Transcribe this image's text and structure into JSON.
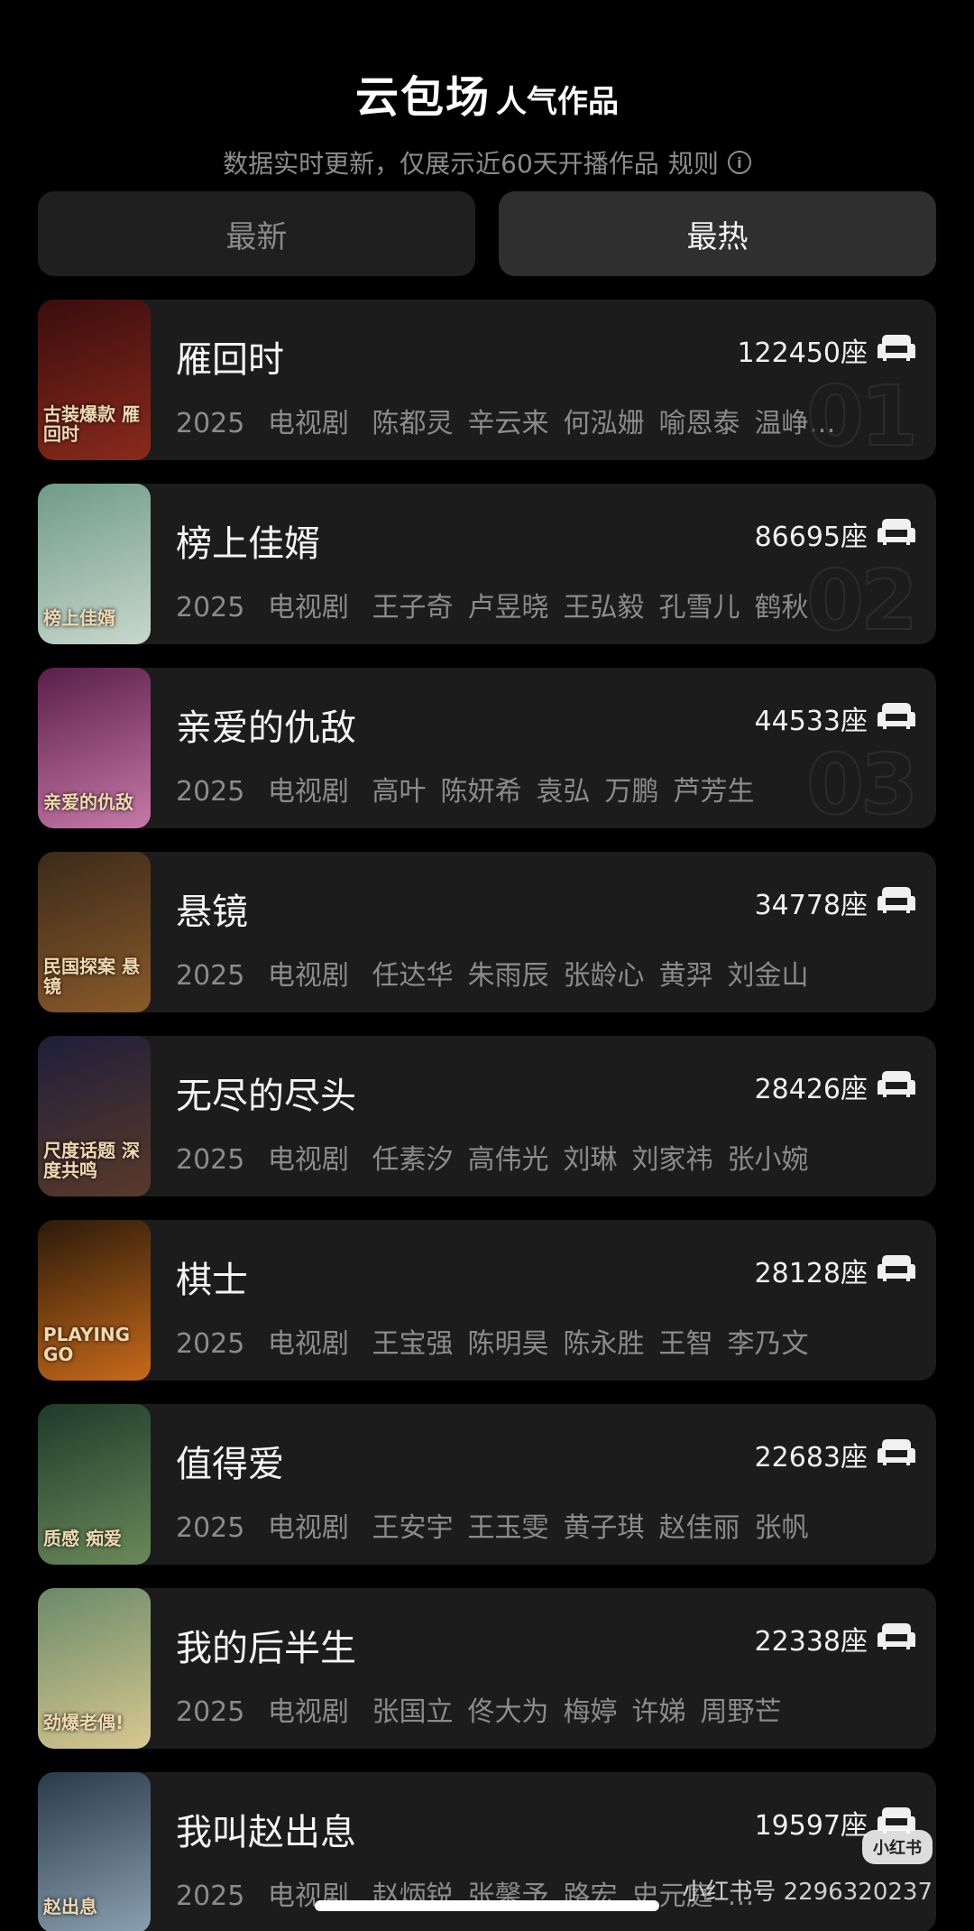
{
  "header": {
    "brand": "云包场",
    "brand_sub": "人气作品",
    "subtitle": "数据实时更新，仅展示近60天开播作品",
    "rules_label": "规则"
  },
  "tabs": [
    {
      "label": "最新",
      "active": false
    },
    {
      "label": "最热",
      "active": true
    }
  ],
  "items": [
    {
      "rank": "01",
      "title": "雁回时",
      "seats": "122450座",
      "year": "2025",
      "category": "电视剧",
      "cast": [
        "陈都灵",
        "辛云来",
        "何泓姗",
        "喻恩泰",
        "温峥…"
      ],
      "poster_text": "古装爆款 雁回时",
      "poster_colors": [
        "#3a0d0d",
        "#8a2a1c"
      ]
    },
    {
      "rank": "02",
      "title": "榜上佳婿",
      "seats": "86695座",
      "year": "2025",
      "category": "电视剧",
      "cast": [
        "王子奇",
        "卢昱晓",
        "王弘毅",
        "孔雪儿",
        "鹤秋"
      ],
      "poster_text": "榜上佳婿",
      "poster_colors": [
        "#6f9a8a",
        "#c8d8cc"
      ]
    },
    {
      "rank": "03",
      "title": "亲爱的仇敌",
      "seats": "44533座",
      "year": "2025",
      "category": "电视剧",
      "cast": [
        "高叶",
        "陈妍希",
        "袁弘",
        "万鹏",
        "芦芳生"
      ],
      "poster_text": "亲爱的仇敌",
      "poster_colors": [
        "#5a1e4a",
        "#c77aa8"
      ]
    },
    {
      "rank": "",
      "title": "悬镜",
      "seats": "34778座",
      "year": "2025",
      "category": "电视剧",
      "cast": [
        "任达华",
        "朱雨辰",
        "张龄心",
        "黄羿",
        "刘金山"
      ],
      "poster_text": "民国探案 悬镜",
      "poster_colors": [
        "#3b2a1a",
        "#8a5a2a"
      ]
    },
    {
      "rank": "",
      "title": "无尽的尽头",
      "seats": "28426座",
      "year": "2025",
      "category": "电视剧",
      "cast": [
        "任素汐",
        "高伟光",
        "刘琳",
        "刘家祎",
        "张小婉"
      ],
      "poster_text": "尺度话题 深度共鸣",
      "poster_colors": [
        "#1e1e3a",
        "#5a3a2a"
      ]
    },
    {
      "rank": "",
      "title": "棋士",
      "seats": "28128座",
      "year": "2025",
      "category": "电视剧",
      "cast": [
        "王宝强",
        "陈明昊",
        "陈永胜",
        "王智",
        "李乃文"
      ],
      "poster_text": "PLAYING GO",
      "poster_colors": [
        "#2a1a0a",
        "#c86a1a"
      ]
    },
    {
      "rank": "",
      "title": "值得爱",
      "seats": "22683座",
      "year": "2025",
      "category": "电视剧",
      "cast": [
        "王安宇",
        "王玉雯",
        "黄子琪",
        "赵佳丽",
        "张帆"
      ],
      "poster_text": "质感 痴爱",
      "poster_colors": [
        "#1e3a2a",
        "#6a8a5a"
      ]
    },
    {
      "rank": "",
      "title": "我的后半生",
      "seats": "22338座",
      "year": "2025",
      "category": "电视剧",
      "cast": [
        "张国立",
        "佟大为",
        "梅婷",
        "许娣",
        "周野芒"
      ],
      "poster_text": "劲爆老偶!",
      "poster_colors": [
        "#6a8a6a",
        "#d8c890"
      ]
    },
    {
      "rank": "",
      "title": "我叫赵出息",
      "seats": "19597座",
      "year": "2025",
      "category": "电视剧",
      "cast": [
        "赵炳锐",
        "张馨予",
        "路宏",
        "史元庭",
        "…"
      ],
      "poster_text": "赵出息",
      "poster_colors": [
        "#2a3a4a",
        "#8aa0b0"
      ]
    }
  ],
  "watermark": {
    "badge": "小红书",
    "id": "小红书号 2296320237"
  }
}
